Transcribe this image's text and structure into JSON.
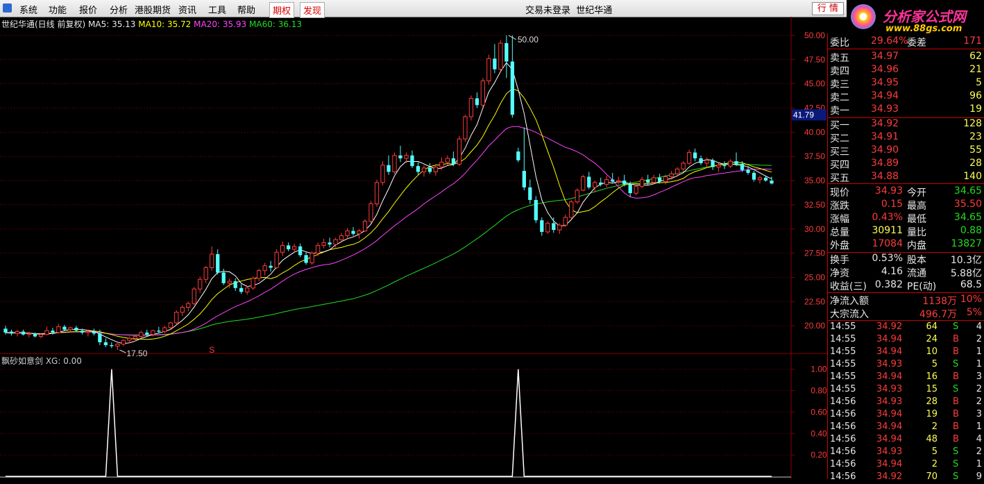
{
  "menu": {
    "items": [
      "系统",
      "功能",
      "报价",
      "分析",
      "港股期货",
      "资讯",
      "工具",
      "帮助"
    ],
    "special": [
      "期权",
      "发现"
    ],
    "status": "交易未登录",
    "stock_name": "世纪华通",
    "hq_button": "行 情"
  },
  "brand": {
    "title": "分析家公式网",
    "url": "www.88gs.com"
  },
  "chart_title": {
    "label": "世纪华通(日线 前复权)",
    "ma5": "MA5: 35.13",
    "ma10": "MA10: 35.72",
    "ma20": "MA20: 35.93",
    "ma60": "MA60: 36.13"
  },
  "colors": {
    "up": "#ff3c3c",
    "down": "#54ffff",
    "ma5": "#ffffff",
    "ma10": "#ffff00",
    "ma20": "#ff44ff",
    "ma60": "#22dd22",
    "grid": "#8b0000",
    "indicator": "#ffffff"
  },
  "indicator_title": "飘砂如意剑 XG: 0.00",
  "chart_data": [
    {
      "type": "candlestick",
      "title": "世纪华通(日线 前复权)",
      "ylim": [
        17.5,
        50.5
      ],
      "yticks": [
        "50.00",
        "47.50",
        "45.00",
        "42.50",
        "40.00",
        "37.50",
        "35.00",
        "32.50",
        "30.00",
        "27.50",
        "25.00",
        "22.50",
        "20.00"
      ],
      "current_price_label": "41.79",
      "annotations": {
        "high": "50.00",
        "low": "17.50",
        "marker": "S"
      },
      "candles": [
        [
          19.7,
          20.0,
          19.1,
          19.3
        ],
        [
          19.4,
          19.6,
          19.0,
          19.2
        ],
        [
          19.2,
          19.6,
          18.9,
          19.4
        ],
        [
          19.4,
          19.6,
          19.0,
          19.1
        ],
        [
          19.1,
          19.4,
          18.8,
          19.2
        ],
        [
          19.2,
          19.3,
          18.8,
          18.9
        ],
        [
          18.9,
          19.2,
          18.7,
          19.1
        ],
        [
          19.1,
          19.9,
          19.0,
          19.5
        ],
        [
          19.5,
          19.8,
          19.1,
          19.3
        ],
        [
          19.3,
          20.2,
          19.2,
          19.9
        ],
        [
          19.9,
          20.1,
          19.5,
          19.6
        ],
        [
          19.6,
          19.9,
          19.3,
          19.8
        ],
        [
          19.8,
          20.0,
          19.4,
          19.5
        ],
        [
          19.5,
          19.7,
          19.1,
          19.3
        ],
        [
          19.3,
          19.6,
          18.9,
          19.4
        ],
        [
          19.4,
          19.7,
          19.0,
          19.2
        ],
        [
          19.2,
          19.6,
          18.0,
          18.3
        ],
        [
          18.3,
          18.7,
          17.8,
          18.0
        ],
        [
          18.0,
          18.3,
          17.7,
          17.9
        ],
        [
          17.9,
          18.2,
          17.5,
          18.1
        ],
        [
          18.1,
          18.6,
          17.9,
          18.5
        ],
        [
          18.5,
          18.9,
          18.2,
          18.7
        ],
        [
          18.7,
          19.1,
          18.4,
          18.9
        ],
        [
          18.9,
          19.5,
          18.7,
          19.3
        ],
        [
          19.3,
          19.6,
          18.9,
          19.1
        ],
        [
          19.1,
          19.6,
          18.9,
          19.5
        ],
        [
          19.5,
          19.9,
          19.2,
          19.4
        ],
        [
          19.4,
          20.0,
          19.2,
          19.8
        ],
        [
          19.8,
          20.4,
          19.6,
          20.3
        ],
        [
          20.3,
          21.6,
          20.1,
          21.4
        ],
        [
          21.4,
          22.1,
          21.0,
          21.9
        ],
        [
          21.9,
          22.5,
          21.5,
          22.3
        ],
        [
          22.3,
          24.0,
          22.1,
          23.8
        ],
        [
          23.8,
          25.1,
          23.4,
          24.8
        ],
        [
          24.8,
          26.2,
          24.4,
          26.0
        ],
        [
          26.0,
          28.2,
          25.7,
          27.4
        ],
        [
          27.4,
          27.9,
          25.3,
          25.5
        ],
        [
          25.5,
          25.9,
          24.2,
          24.4
        ],
        [
          24.4,
          24.9,
          23.9,
          24.6
        ],
        [
          24.6,
          24.9,
          23.6,
          23.9
        ],
        [
          23.9,
          24.3,
          23.3,
          23.5
        ],
        [
          23.5,
          24.1,
          23.2,
          23.9
        ],
        [
          23.9,
          25.1,
          23.7,
          24.9
        ],
        [
          24.9,
          25.9,
          24.6,
          25.7
        ],
        [
          25.7,
          26.5,
          25.2,
          26.2
        ],
        [
          26.2,
          26.7,
          25.6,
          26.0
        ],
        [
          26.0,
          27.9,
          25.9,
          27.6
        ],
        [
          27.6,
          28.7,
          27.2,
          28.3
        ],
        [
          28.3,
          28.6,
          27.7,
          27.9
        ],
        [
          27.9,
          28.5,
          27.6,
          28.2
        ],
        [
          28.2,
          28.5,
          27.1,
          27.3
        ],
        [
          27.3,
          27.6,
          26.3,
          26.5
        ],
        [
          26.5,
          27.7,
          26.3,
          27.5
        ],
        [
          27.5,
          28.6,
          27.2,
          28.3
        ],
        [
          28.3,
          29.0,
          28.0,
          28.6
        ],
        [
          28.6,
          29.1,
          28.1,
          28.4
        ],
        [
          28.4,
          29.1,
          28.1,
          28.9
        ],
        [
          28.9,
          29.6,
          28.6,
          29.3
        ],
        [
          29.3,
          30.1,
          28.9,
          29.8
        ],
        [
          29.8,
          30.2,
          29.3,
          29.5
        ],
        [
          29.5,
          30.0,
          29.0,
          29.8
        ],
        [
          29.8,
          31.0,
          29.7,
          30.8
        ],
        [
          30.8,
          32.9,
          30.6,
          32.6
        ],
        [
          32.6,
          35.1,
          32.3,
          34.8
        ],
        [
          34.8,
          37.0,
          34.5,
          36.6
        ],
        [
          36.6,
          37.6,
          35.6,
          35.9
        ],
        [
          35.9,
          37.9,
          35.7,
          37.6
        ],
        [
          37.6,
          38.6,
          36.9,
          37.3
        ],
        [
          37.3,
          37.9,
          36.8,
          37.6
        ],
        [
          37.6,
          38.1,
          36.3,
          36.5
        ],
        [
          36.5,
          36.9,
          35.6,
          35.9
        ],
        [
          35.9,
          36.6,
          35.4,
          36.3
        ],
        [
          36.3,
          36.8,
          35.7,
          35.9
        ],
        [
          35.9,
          36.7,
          35.5,
          36.4
        ],
        [
          36.4,
          37.4,
          36.1,
          36.9
        ],
        [
          36.9,
          37.6,
          36.6,
          37.3
        ],
        [
          37.3,
          38.0,
          36.5,
          36.7
        ],
        [
          36.7,
          39.6,
          36.5,
          39.3
        ],
        [
          39.3,
          41.8,
          39.0,
          41.6
        ],
        [
          41.6,
          43.8,
          41.2,
          43.5
        ],
        [
          43.5,
          44.1,
          42.5,
          42.8
        ],
        [
          42.8,
          45.6,
          42.6,
          45.3
        ],
        [
          45.3,
          48.0,
          44.9,
          47.6
        ],
        [
          47.6,
          49.1,
          46.1,
          46.5
        ],
        [
          46.5,
          49.5,
          46.3,
          49.2
        ],
        [
          49.2,
          50.0,
          45.6,
          47.3
        ],
        [
          47.3,
          50.0,
          41.5,
          41.8
        ],
        [
          38.0,
          38.4,
          36.9,
          37.1
        ],
        [
          36.0,
          40.5,
          34.0,
          34.3
        ],
        [
          34.3,
          35.1,
          32.6,
          33.0
        ],
        [
          33.0,
          33.4,
          30.6,
          30.9
        ],
        [
          30.9,
          31.2,
          29.3,
          29.7
        ],
        [
          29.7,
          30.8,
          29.5,
          30.6
        ],
        [
          30.6,
          31.2,
          29.6,
          29.9
        ],
        [
          29.9,
          30.6,
          29.5,
          30.4
        ],
        [
          30.4,
          31.5,
          30.2,
          31.2
        ],
        [
          31.2,
          33.0,
          31.1,
          32.8
        ],
        [
          32.8,
          34.2,
          32.6,
          34.0
        ],
        [
          34.0,
          35.6,
          33.9,
          35.4
        ],
        [
          35.4,
          35.9,
          34.1,
          34.3
        ],
        [
          34.3,
          35.0,
          33.8,
          34.8
        ],
        [
          34.8,
          35.3,
          34.4,
          34.6
        ],
        [
          34.6,
          35.5,
          34.3,
          35.1
        ],
        [
          35.1,
          35.8,
          34.7,
          34.9
        ],
        [
          34.9,
          35.4,
          34.6,
          35.0
        ],
        [
          35.0,
          35.6,
          34.4,
          34.6
        ],
        [
          34.6,
          34.9,
          33.3,
          33.7
        ],
        [
          33.7,
          34.6,
          33.5,
          34.4
        ],
        [
          34.4,
          35.4,
          34.2,
          35.1
        ],
        [
          35.1,
          35.6,
          34.5,
          34.8
        ],
        [
          34.8,
          35.6,
          34.6,
          35.3
        ],
        [
          35.3,
          35.7,
          34.7,
          34.9
        ],
        [
          34.9,
          35.6,
          34.6,
          35.4
        ],
        [
          35.4,
          36.0,
          35.1,
          35.7
        ],
        [
          35.7,
          36.4,
          35.4,
          36.2
        ],
        [
          36.2,
          37.0,
          35.9,
          36.8
        ],
        [
          36.8,
          38.2,
          36.6,
          37.9
        ],
        [
          37.9,
          38.3,
          37.0,
          37.3
        ],
        [
          37.3,
          37.6,
          36.6,
          36.8
        ],
        [
          36.8,
          37.4,
          36.3,
          37.1
        ],
        [
          37.1,
          37.3,
          36.1,
          36.4
        ],
        [
          36.4,
          36.8,
          35.9,
          36.6
        ],
        [
          36.6,
          37.0,
          36.2,
          36.5
        ],
        [
          36.5,
          37.2,
          36.3,
          37.0
        ],
        [
          37.0,
          37.9,
          36.5,
          36.7
        ],
        [
          36.7,
          37.0,
          35.9,
          36.1
        ],
        [
          36.1,
          36.5,
          35.6,
          35.8
        ],
        [
          35.8,
          36.0,
          34.9,
          35.1
        ],
        [
          35.1,
          35.5,
          34.7,
          35.3
        ],
        [
          35.3,
          35.5,
          34.9,
          35.0
        ],
        [
          35.0,
          35.4,
          34.6,
          34.7
        ]
      ]
    },
    {
      "type": "line",
      "title": "飘砂如意剑",
      "ylim": [
        0,
        1.05
      ],
      "yticks": [
        "1.00",
        "0.80",
        "0.60",
        "0.40",
        "0.20"
      ],
      "series": [
        {
          "name": "XG",
          "signal_index": [
            18,
            87
          ]
        }
      ]
    }
  ],
  "orderbook": {
    "weibi": {
      "label": "委比",
      "value": "29.64%",
      "label2": "委差",
      "value2": "171"
    },
    "asks": [
      {
        "label": "卖五",
        "price": "34.97",
        "vol": "62"
      },
      {
        "label": "卖四",
        "price": "34.96",
        "vol": "21"
      },
      {
        "label": "卖三",
        "price": "34.95",
        "vol": "5"
      },
      {
        "label": "卖二",
        "price": "34.94",
        "vol": "96"
      },
      {
        "label": "卖一",
        "price": "34.93",
        "vol": "19"
      }
    ],
    "bids": [
      {
        "label": "买一",
        "price": "34.92",
        "vol": "128"
      },
      {
        "label": "买二",
        "price": "34.91",
        "vol": "23"
      },
      {
        "label": "买三",
        "price": "34.90",
        "vol": "55"
      },
      {
        "label": "买四",
        "price": "34.89",
        "vol": "28"
      },
      {
        "label": "买五",
        "price": "34.88",
        "vol": "140"
      }
    ]
  },
  "quote": [
    {
      "l1": "现价",
      "v1": "34.93",
      "c1": "red",
      "l2": "今开",
      "v2": "34.65",
      "c2": "grn"
    },
    {
      "l1": "涨跌",
      "v1": "0.15",
      "c1": "red",
      "l2": "最高",
      "v2": "35.50",
      "c2": "red"
    },
    {
      "l1": "涨幅",
      "v1": "0.43%",
      "c1": "red",
      "l2": "最低",
      "v2": "34.65",
      "c2": "grn"
    },
    {
      "l1": "总量",
      "v1": "30911",
      "c1": "yel",
      "l2": "量比",
      "v2": "0.88",
      "c2": "grn"
    },
    {
      "l1": "外盘",
      "v1": "17084",
      "c1": "red",
      "l2": "内盘",
      "v2": "13827",
      "c2": "grn"
    }
  ],
  "fundamentals": [
    {
      "l1": "换手",
      "v1": "0.53%",
      "l2": "股本",
      "v2": "10.3亿"
    },
    {
      "l1": "净资",
      "v1": "4.16",
      "l2": "流通",
      "v2": "5.88亿"
    },
    {
      "l1": "收益(三)",
      "v1": "0.382",
      "l2": "PE(动)",
      "v2": "68.5"
    }
  ],
  "flow": [
    {
      "label": "净流入额",
      "value": "1138万",
      "pct": "10%"
    },
    {
      "label": "大宗流入",
      "value": "496.7万",
      "pct": "5%"
    }
  ],
  "ticks": [
    {
      "time": "14:55",
      "price": "34.92",
      "vol": "64",
      "side": "S",
      "n": "4"
    },
    {
      "time": "14:55",
      "price": "34.94",
      "vol": "24",
      "side": "B",
      "n": "2"
    },
    {
      "time": "14:55",
      "price": "34.94",
      "vol": "10",
      "side": "B",
      "n": "1"
    },
    {
      "time": "14:55",
      "price": "34.93",
      "vol": "5",
      "side": "S",
      "n": "1"
    },
    {
      "time": "14:55",
      "price": "34.94",
      "vol": "16",
      "side": "B",
      "n": "3"
    },
    {
      "time": "14:55",
      "price": "34.93",
      "vol": "15",
      "side": "S",
      "n": "2"
    },
    {
      "time": "14:56",
      "price": "34.93",
      "vol": "28",
      "side": "B",
      "n": "2"
    },
    {
      "time": "14:56",
      "price": "34.94",
      "vol": "19",
      "side": "B",
      "n": "3"
    },
    {
      "time": "14:56",
      "price": "34.94",
      "vol": "2",
      "side": "B",
      "n": "1"
    },
    {
      "time": "14:56",
      "price": "34.94",
      "vol": "48",
      "side": "B",
      "n": "4"
    },
    {
      "time": "14:56",
      "price": "34.93",
      "vol": "5",
      "side": "S",
      "n": "2"
    },
    {
      "time": "14:56",
      "price": "34.94",
      "vol": "2",
      "side": "S",
      "n": "1"
    },
    {
      "time": "14:56",
      "price": "34.92",
      "vol": "70",
      "side": "S",
      "n": "9"
    }
  ]
}
